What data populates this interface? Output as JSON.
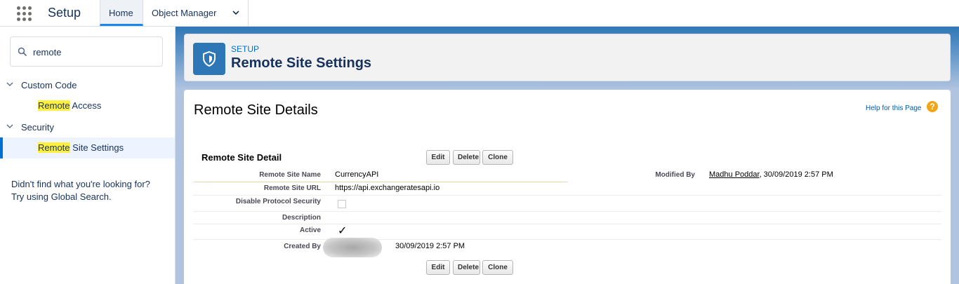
{
  "topnav": {
    "app_name": "Setup",
    "tabs": [
      {
        "label": "Home"
      },
      {
        "label": "Object Manager"
      }
    ]
  },
  "sidebar": {
    "search_value": "remote",
    "sections": [
      {
        "label": "Custom Code",
        "items": [
          {
            "highlight": "Remote",
            "rest": " Access"
          }
        ]
      },
      {
        "label": "Security",
        "items": [
          {
            "highlight": "Remote",
            "rest": " Site Settings"
          }
        ]
      }
    ],
    "no_result_line1": "Didn't find what you're looking for?",
    "no_result_line2": "Try using Global Search."
  },
  "header": {
    "eyebrow": "SETUP",
    "title": "Remote Site Settings"
  },
  "content": {
    "page_title": "Remote Site Details",
    "help_link": "Help for this Page",
    "help_icon": "?",
    "section_title": "Remote Site Detail",
    "buttons": {
      "edit": "Edit",
      "delete": "Delete",
      "clone": "Clone"
    },
    "fields": {
      "remote_site_name_label": "Remote Site Name",
      "remote_site_name_value": "CurrencyAPI",
      "remote_site_url_label": "Remote Site URL",
      "remote_site_url_value": "https://api.exchangeratesapi.io",
      "disable_protocol_label": "Disable Protocol Security",
      "description_label": "Description",
      "active_label": "Active",
      "active_check": "✓",
      "created_by_label": "Created By",
      "created_by_value": "30/09/2019 2:57 PM",
      "modified_by_label": "Modified By",
      "modified_by_name": "Madhu Poddar",
      "modified_by_date": ", 30/09/2019 2:57 PM"
    }
  },
  "colors": {
    "brand_blue": "#2d77b6",
    "link_blue": "#0070d2",
    "highlight": "#fff03f"
  }
}
